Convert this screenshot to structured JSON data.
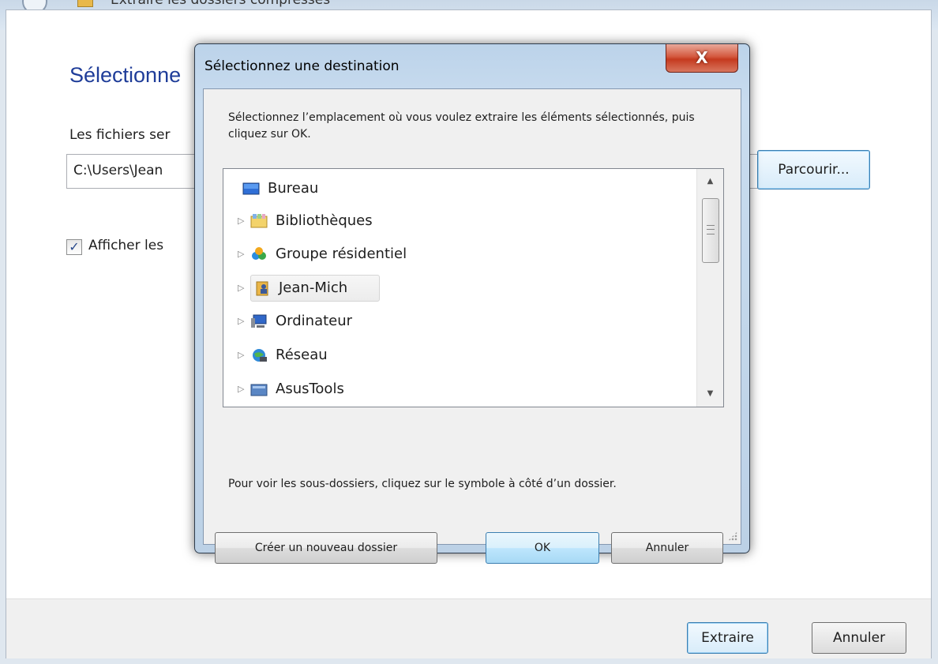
{
  "wizard": {
    "window_title": "Extraire les dossiers compressés",
    "heading": "Sélectionne",
    "destination_label": "Les fichiers ser",
    "path_value": "C:\\Users\\Jean",
    "browse_label": "Parcourir...",
    "show_checkbox_checked": true,
    "show_label": "Afficher les",
    "extract_label": "Extraire",
    "cancel_label": "Annuler"
  },
  "dialog": {
    "title": "Sélectionnez une destination",
    "close_glyph": "X",
    "instructions": "Sélectionnez l’emplacement où vous voulez extraire les éléments sélectionnés, puis cliquez sur OK.",
    "tree": {
      "items": [
        {
          "label": "Bureau",
          "icon": "desktop-icon",
          "expandable": false,
          "selected": false
        },
        {
          "label": "Bibliothèques",
          "icon": "libraries-icon",
          "expandable": true,
          "selected": false
        },
        {
          "label": "Groupe résidentiel",
          "icon": "homegroup-icon",
          "expandable": true,
          "selected": false
        },
        {
          "label": "Jean-Mich",
          "icon": "user-folder-icon",
          "expandable": true,
          "selected": true
        },
        {
          "label": "Ordinateur",
          "icon": "computer-icon",
          "expandable": true,
          "selected": false
        },
        {
          "label": "Réseau",
          "icon": "network-icon",
          "expandable": true,
          "selected": false
        },
        {
          "label": "AsusTools",
          "icon": "folder-icon",
          "expandable": true,
          "selected": false
        }
      ]
    },
    "hint": "Pour voir les sous-dossiers, cliquez sur le symbole à côté d’un dossier.",
    "new_folder_label": "Créer un nouveau dossier",
    "ok_label": "OK",
    "cancel_label": "Annuler"
  },
  "colors": {
    "heading_blue": "#1f3d99",
    "close_red": "#c53a1f",
    "default_button_border": "#3c7fb1"
  }
}
